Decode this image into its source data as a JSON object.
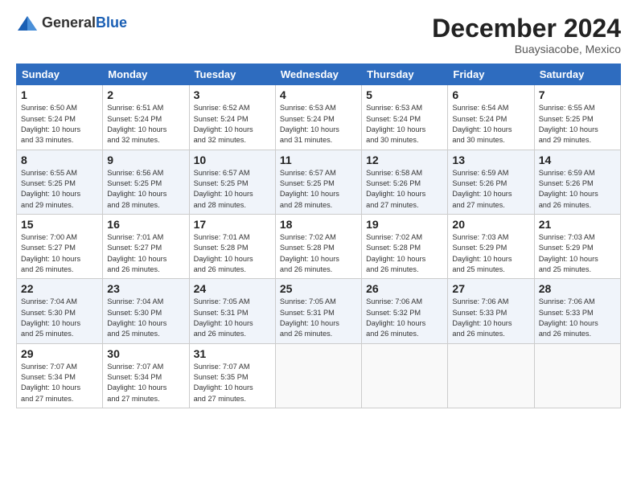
{
  "header": {
    "logo_general": "General",
    "logo_blue": "Blue",
    "month_title": "December 2024",
    "location": "Buaysiacobe, Mexico"
  },
  "days_of_week": [
    "Sunday",
    "Monday",
    "Tuesday",
    "Wednesday",
    "Thursday",
    "Friday",
    "Saturday"
  ],
  "weeks": [
    [
      {
        "day": "1",
        "info": "Sunrise: 6:50 AM\nSunset: 5:24 PM\nDaylight: 10 hours\nand 33 minutes."
      },
      {
        "day": "2",
        "info": "Sunrise: 6:51 AM\nSunset: 5:24 PM\nDaylight: 10 hours\nand 32 minutes."
      },
      {
        "day": "3",
        "info": "Sunrise: 6:52 AM\nSunset: 5:24 PM\nDaylight: 10 hours\nand 32 minutes."
      },
      {
        "day": "4",
        "info": "Sunrise: 6:53 AM\nSunset: 5:24 PM\nDaylight: 10 hours\nand 31 minutes."
      },
      {
        "day": "5",
        "info": "Sunrise: 6:53 AM\nSunset: 5:24 PM\nDaylight: 10 hours\nand 30 minutes."
      },
      {
        "day": "6",
        "info": "Sunrise: 6:54 AM\nSunset: 5:24 PM\nDaylight: 10 hours\nand 30 minutes."
      },
      {
        "day": "7",
        "info": "Sunrise: 6:55 AM\nSunset: 5:25 PM\nDaylight: 10 hours\nand 29 minutes."
      }
    ],
    [
      {
        "day": "8",
        "info": "Sunrise: 6:55 AM\nSunset: 5:25 PM\nDaylight: 10 hours\nand 29 minutes."
      },
      {
        "day": "9",
        "info": "Sunrise: 6:56 AM\nSunset: 5:25 PM\nDaylight: 10 hours\nand 28 minutes."
      },
      {
        "day": "10",
        "info": "Sunrise: 6:57 AM\nSunset: 5:25 PM\nDaylight: 10 hours\nand 28 minutes."
      },
      {
        "day": "11",
        "info": "Sunrise: 6:57 AM\nSunset: 5:25 PM\nDaylight: 10 hours\nand 28 minutes."
      },
      {
        "day": "12",
        "info": "Sunrise: 6:58 AM\nSunset: 5:26 PM\nDaylight: 10 hours\nand 27 minutes."
      },
      {
        "day": "13",
        "info": "Sunrise: 6:59 AM\nSunset: 5:26 PM\nDaylight: 10 hours\nand 27 minutes."
      },
      {
        "day": "14",
        "info": "Sunrise: 6:59 AM\nSunset: 5:26 PM\nDaylight: 10 hours\nand 26 minutes."
      }
    ],
    [
      {
        "day": "15",
        "info": "Sunrise: 7:00 AM\nSunset: 5:27 PM\nDaylight: 10 hours\nand 26 minutes."
      },
      {
        "day": "16",
        "info": "Sunrise: 7:01 AM\nSunset: 5:27 PM\nDaylight: 10 hours\nand 26 minutes."
      },
      {
        "day": "17",
        "info": "Sunrise: 7:01 AM\nSunset: 5:28 PM\nDaylight: 10 hours\nand 26 minutes."
      },
      {
        "day": "18",
        "info": "Sunrise: 7:02 AM\nSunset: 5:28 PM\nDaylight: 10 hours\nand 26 minutes."
      },
      {
        "day": "19",
        "info": "Sunrise: 7:02 AM\nSunset: 5:28 PM\nDaylight: 10 hours\nand 26 minutes."
      },
      {
        "day": "20",
        "info": "Sunrise: 7:03 AM\nSunset: 5:29 PM\nDaylight: 10 hours\nand 25 minutes."
      },
      {
        "day": "21",
        "info": "Sunrise: 7:03 AM\nSunset: 5:29 PM\nDaylight: 10 hours\nand 25 minutes."
      }
    ],
    [
      {
        "day": "22",
        "info": "Sunrise: 7:04 AM\nSunset: 5:30 PM\nDaylight: 10 hours\nand 25 minutes."
      },
      {
        "day": "23",
        "info": "Sunrise: 7:04 AM\nSunset: 5:30 PM\nDaylight: 10 hours\nand 25 minutes."
      },
      {
        "day": "24",
        "info": "Sunrise: 7:05 AM\nSunset: 5:31 PM\nDaylight: 10 hours\nand 26 minutes."
      },
      {
        "day": "25",
        "info": "Sunrise: 7:05 AM\nSunset: 5:31 PM\nDaylight: 10 hours\nand 26 minutes."
      },
      {
        "day": "26",
        "info": "Sunrise: 7:06 AM\nSunset: 5:32 PM\nDaylight: 10 hours\nand 26 minutes."
      },
      {
        "day": "27",
        "info": "Sunrise: 7:06 AM\nSunset: 5:33 PM\nDaylight: 10 hours\nand 26 minutes."
      },
      {
        "day": "28",
        "info": "Sunrise: 7:06 AM\nSunset: 5:33 PM\nDaylight: 10 hours\nand 26 minutes."
      }
    ],
    [
      {
        "day": "29",
        "info": "Sunrise: 7:07 AM\nSunset: 5:34 PM\nDaylight: 10 hours\nand 27 minutes."
      },
      {
        "day": "30",
        "info": "Sunrise: 7:07 AM\nSunset: 5:34 PM\nDaylight: 10 hours\nand 27 minutes."
      },
      {
        "day": "31",
        "info": "Sunrise: 7:07 AM\nSunset: 5:35 PM\nDaylight: 10 hours\nand 27 minutes."
      },
      {
        "day": "",
        "info": ""
      },
      {
        "day": "",
        "info": ""
      },
      {
        "day": "",
        "info": ""
      },
      {
        "day": "",
        "info": ""
      }
    ]
  ]
}
